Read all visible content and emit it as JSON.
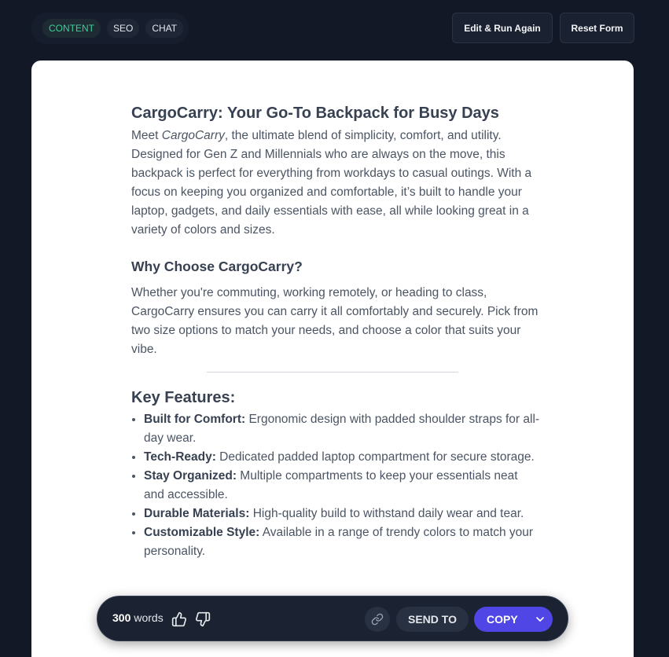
{
  "tabs": [
    {
      "label": "CONTENT",
      "active": true
    },
    {
      "label": "SEO",
      "active": false
    },
    {
      "label": "CHAT",
      "active": false
    }
  ],
  "toolbar": {
    "edit_label": "Edit & Run Again",
    "reset_label": "Reset Form"
  },
  "article": {
    "title": "CargoCarry: Your Go-To Backpack for Busy Days",
    "intro_prefix": "Meet ",
    "intro_product": "CargoCarry",
    "intro_rest": ", the ultimate blend of simplicity, comfort, and utility. Designed for Gen Z and Millennials who are always on the move, this backpack is perfect for everything from workdays to casual outings. With a focus on keeping you organized and comfortable, it’s built to handle your laptop, gadgets, and daily essentials with ease, all while looking great in a variety of colors and sizes.",
    "why_heading": "Why Choose CargoCarry?",
    "why_text": "Whether you're commuting, working remotely, or heading to class, CargoCarry ensures you can carry it all comfortably and securely. Pick from two size options to match your needs, and choose a color that suits your vibe.",
    "features_heading": "Key Features:",
    "features": [
      {
        "name": "Built for Comfort:",
        "text": " Ergonomic design with padded shoulder straps for all-day wear."
      },
      {
        "name": "Tech-Ready:",
        "text": " Dedicated padded laptop compartment for secure storage."
      },
      {
        "name": "Stay Organized:",
        "text": " Multiple compartments to keep your essentials neat and accessible."
      },
      {
        "name": "Durable Materials:",
        "text": " High-quality build to withstand daily wear and tear."
      },
      {
        "name": "Customizable Style:",
        "text": " Available in a range of trendy colors to match your personality."
      }
    ]
  },
  "actionbar": {
    "word_count": "300",
    "word_label": "words",
    "send_label": "SEND TO",
    "copy_label": "COPY"
  },
  "colors": {
    "background": "#121826",
    "accent": "#4f46e5",
    "active_tab": "#34d399"
  },
  "icons": [
    "thumbs-up-icon",
    "thumbs-down-icon",
    "link-icon",
    "chevron-down-icon"
  ]
}
